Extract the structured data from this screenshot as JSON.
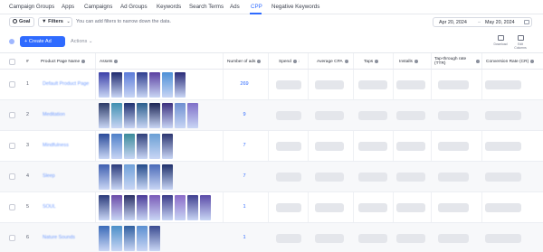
{
  "nav": {
    "tabs": [
      {
        "label": "Campaign Groups",
        "active": false
      },
      {
        "label": "Apps",
        "active": false
      },
      {
        "label": "Campaigns",
        "active": false
      },
      {
        "label": "Ad Groups",
        "active": false
      },
      {
        "label": "Keywords",
        "active": false
      },
      {
        "label": "Search Terms",
        "active": false
      },
      {
        "label": "Ads",
        "active": false
      },
      {
        "label": "CPP",
        "active": true
      },
      {
        "label": "Negative Keywords",
        "active": false
      }
    ],
    "accent": "#2f6bff"
  },
  "filters": {
    "goal_label": "Goal",
    "filters_label": "Filters",
    "hint": "You can add filters to narrow down the data.",
    "date_start": "Apr 20, 2024",
    "date_sep": "–",
    "date_end": "May 20, 2024"
  },
  "toolbar": {
    "create_label": "+ Create Ad",
    "actions_label": "Actions",
    "download_label": "Download",
    "columns_label": "Edit Columns"
  },
  "table": {
    "columns": {
      "number": "#",
      "name": "Product Page Name",
      "assets": "Assets",
      "ads": "Number of ads",
      "spend": "Spend",
      "cpa": "Average CPA",
      "taps": "Taps",
      "installs": "Installs",
      "ttr": "Tap-through rate (TTR)",
      "cr": "Conversion Rate (CR)"
    },
    "rows": [
      {
        "num": "1",
        "name": "Default Product Page",
        "ads": "269",
        "thumbs": [
          "#3b3fa8",
          "#1f2a6e",
          "#5b7bd8",
          "#2f3e8e",
          "#5a3fa0",
          "#4c8fd6",
          "#2a2c78"
        ]
      },
      {
        "num": "2",
        "name": "Meditation",
        "ads": "9",
        "thumbs": [
          "#2b3a66",
          "#3e8fb0",
          "#1e3070",
          "#2a5e8c",
          "#1b2454",
          "#3a2f7e",
          "#6e8fd0",
          "#7f6fc8"
        ]
      },
      {
        "num": "3",
        "name": "Mindfulness",
        "ads": "7",
        "thumbs": [
          "#2a4a9a",
          "#4d7fc8",
          "#3a8a9a",
          "#2f3f7a",
          "#6a9fd4",
          "#2b3570"
        ]
      },
      {
        "num": "4",
        "name": "Sleep",
        "ads": "7",
        "thumbs": [
          "#3f5fb0",
          "#2a3a7a",
          "#6fa0d8",
          "#234a8a",
          "#4a6ab8",
          "#1e2f6a"
        ]
      },
      {
        "num": "5",
        "name": "SOUL",
        "ads": "1",
        "thumbs": [
          "#2a3a7a",
          "#6a4aa8",
          "#2b2f66",
          "#4a3a98",
          "#7a5ab8",
          "#3a3a88",
          "#8a6ac8",
          "#3f3f90",
          "#5a4aa8"
        ]
      },
      {
        "num": "6",
        "name": "Nature Sounds",
        "ads": "1",
        "thumbs": [
          "#3a6ab8",
          "#4a8fc8",
          "#2f5fa0",
          "#5a8fd0",
          "#3a4a90"
        ]
      }
    ]
  }
}
